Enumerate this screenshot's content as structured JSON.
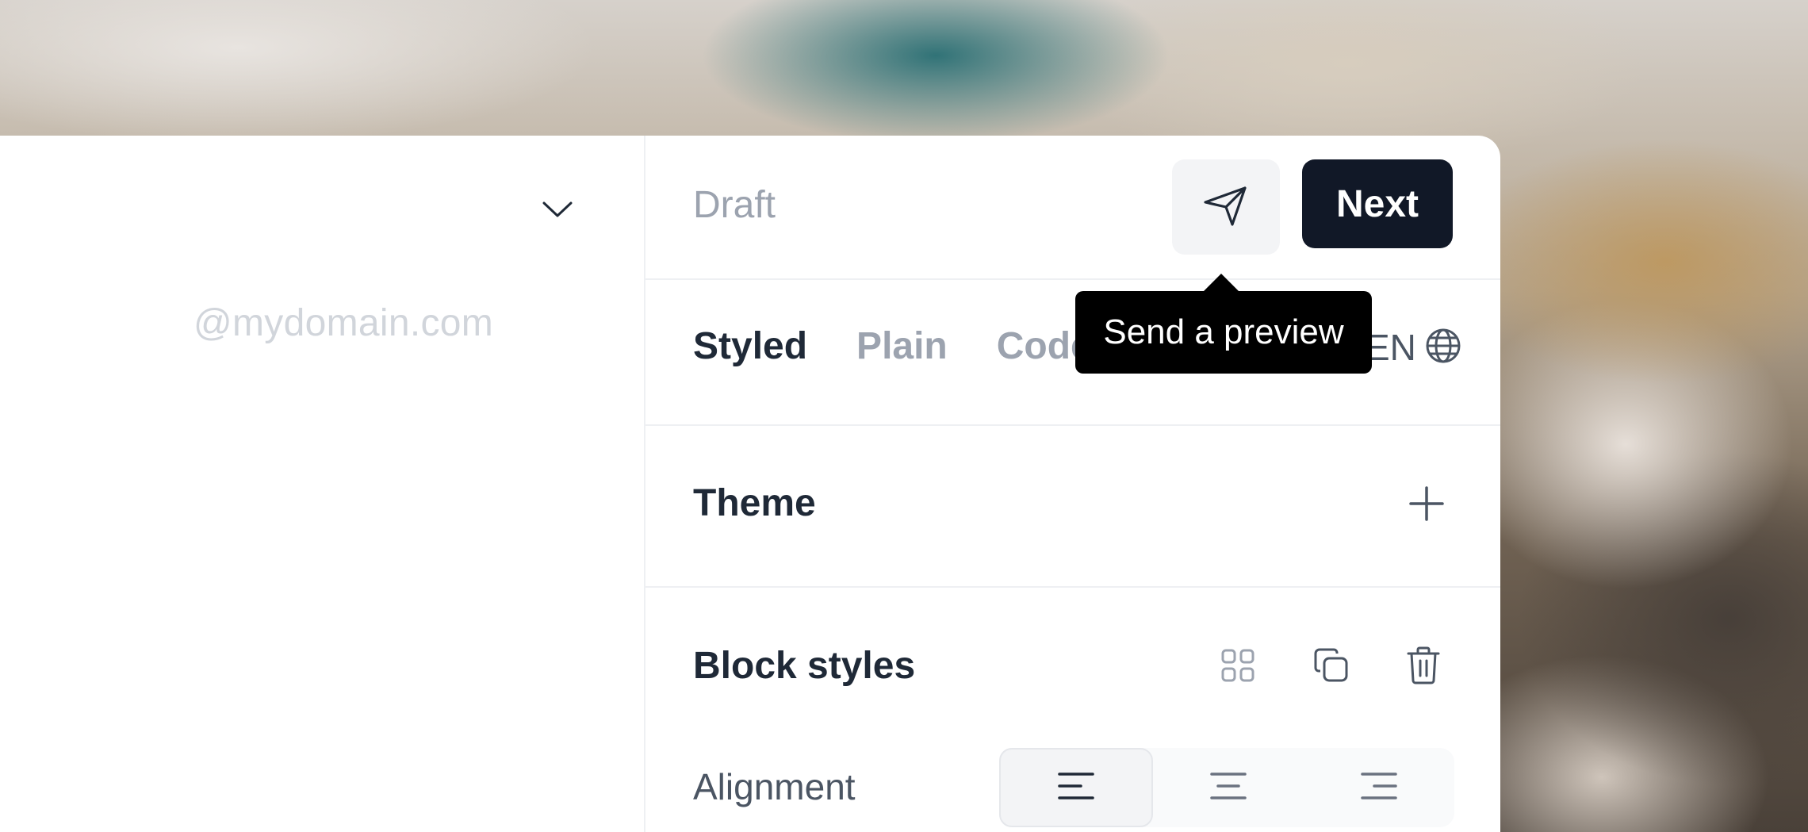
{
  "left": {
    "domain_placeholder": "@mydomain.com",
    "chevron_icon": "chevron-down-icon"
  },
  "header": {
    "status": "Draft",
    "send_preview_icon": "paper-plane-icon",
    "next_label": "Next"
  },
  "tooltip": {
    "text": "Send a preview"
  },
  "tabs": [
    {
      "label": "Styled",
      "active": true
    },
    {
      "label": "Plain",
      "active": false
    },
    {
      "label": "Code",
      "active": false
    }
  ],
  "language": {
    "code": "EN",
    "icon": "globe-icon"
  },
  "theme": {
    "title": "Theme",
    "add_icon": "plus-icon"
  },
  "block_styles": {
    "title": "Block styles",
    "icons": [
      "grid-icon",
      "duplicate-icon",
      "trash-icon"
    ],
    "alignment_label": "Alignment",
    "alignment_options": [
      "align-left-icon",
      "align-center-icon",
      "align-right-icon"
    ],
    "alignment_selected": "left"
  },
  "colors": {
    "accent": "#111827",
    "muted": "#9ca3af",
    "tooltip_bg": "#000000"
  }
}
